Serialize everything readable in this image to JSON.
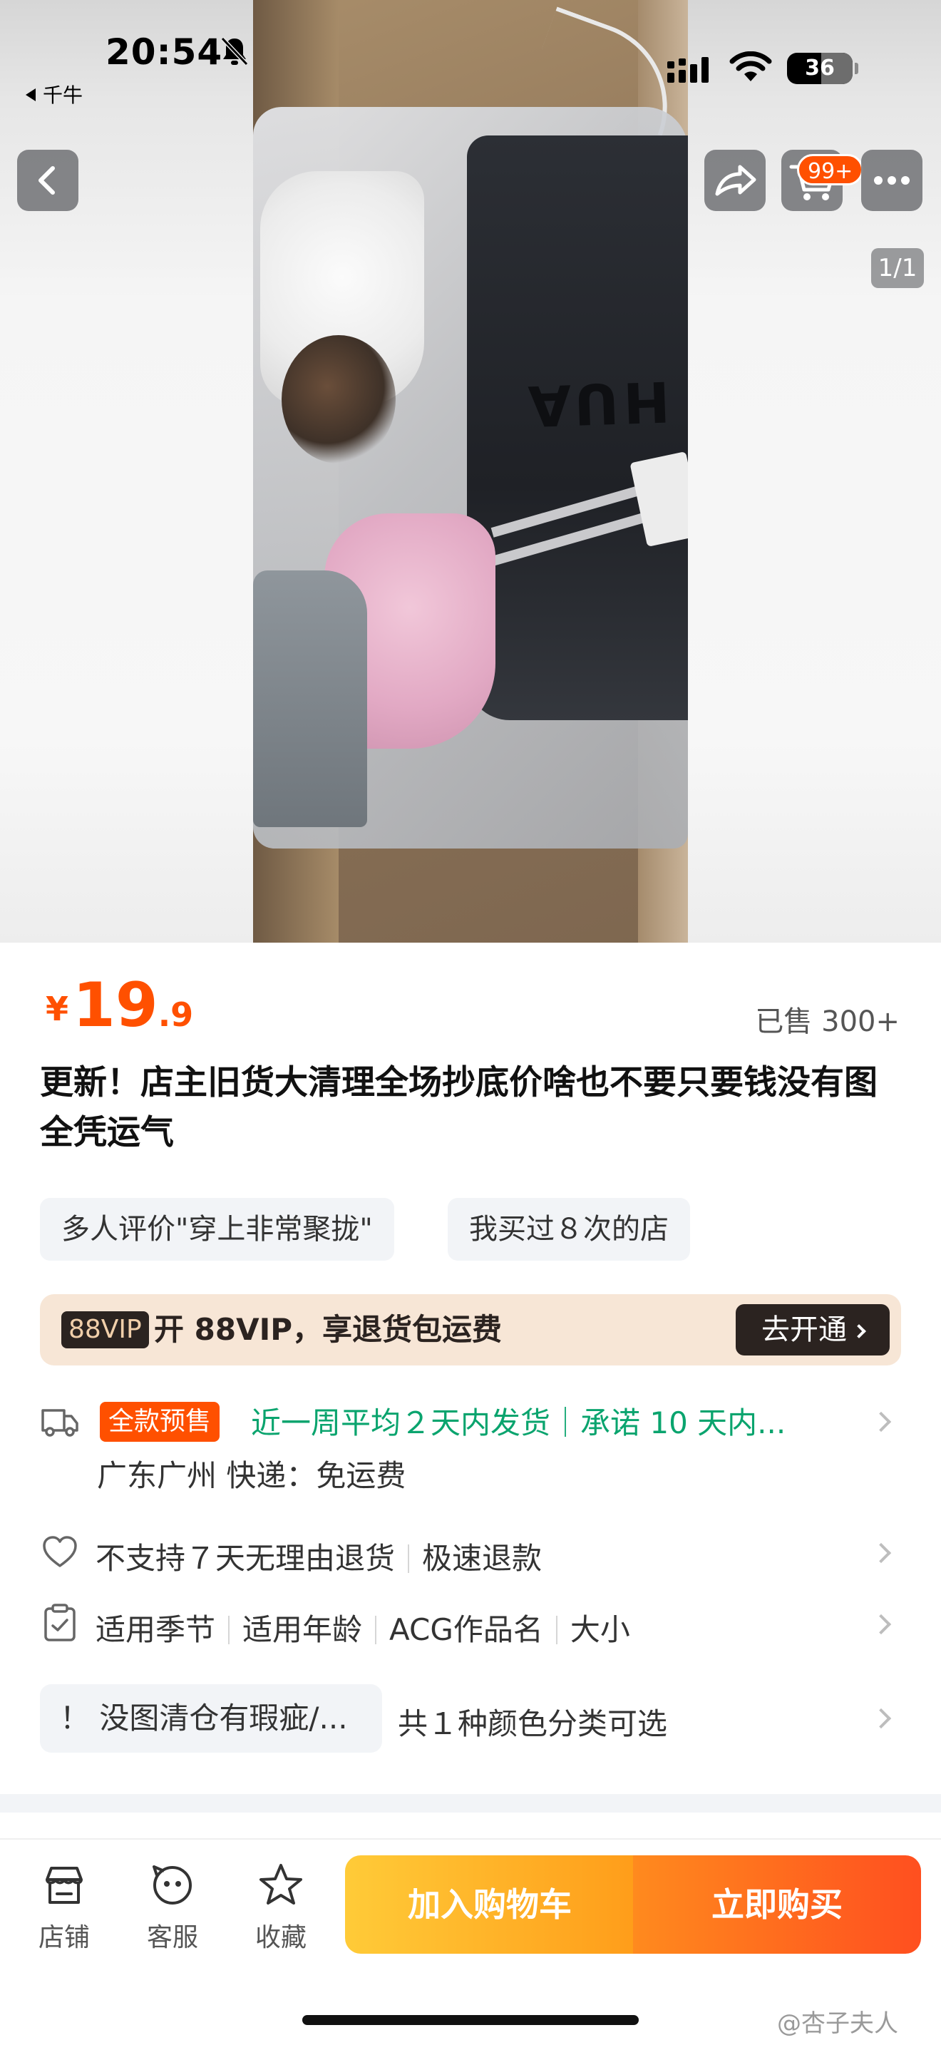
{
  "status_bar": {
    "time": "20:54",
    "back_app_label": "千牛",
    "battery_level": "36"
  },
  "hero": {
    "cart_badge": "99+",
    "page_counter": "1/1"
  },
  "product": {
    "currency": "¥",
    "price_int": "19",
    "price_dec": ".9",
    "sold": "已售 300+",
    "title": "更新！店主旧货大清理全场抄底价啥也不要只要钱没有图全凭运气",
    "tags": [
      "多人评价\"穿上非常聚拢\"",
      "我买过８次的店"
    ]
  },
  "vip": {
    "badge": "88VIP",
    "text": "开 88VIP，享退货包运费",
    "button": "去开通"
  },
  "shipping": {
    "presale_badge": "全款预售",
    "promise": "近一周平均２天内发货｜承诺 10 天内...",
    "location": "广东广州  快递：免运费"
  },
  "service": {
    "items": [
      "不支持７天无理由退货",
      "极速退款"
    ]
  },
  "params": {
    "items": [
      "适用季节",
      "适用年龄",
      "ACG作品名",
      "大小"
    ]
  },
  "sku": {
    "chip": "！ 没图清仓有瑕疵/...",
    "text": "共１种颜色分类可选"
  },
  "bottom_bar": {
    "tabs": [
      "店铺",
      "客服",
      "收藏"
    ],
    "add_to_cart": "加入购物车",
    "buy_now": "立即购买"
  },
  "watermark": "@杏子夫人",
  "colors": {
    "accent": "#ff5000",
    "promise_green": "#0aa46e",
    "vip_dark": "#2b2320",
    "vip_bg": "#f7e6d6"
  }
}
